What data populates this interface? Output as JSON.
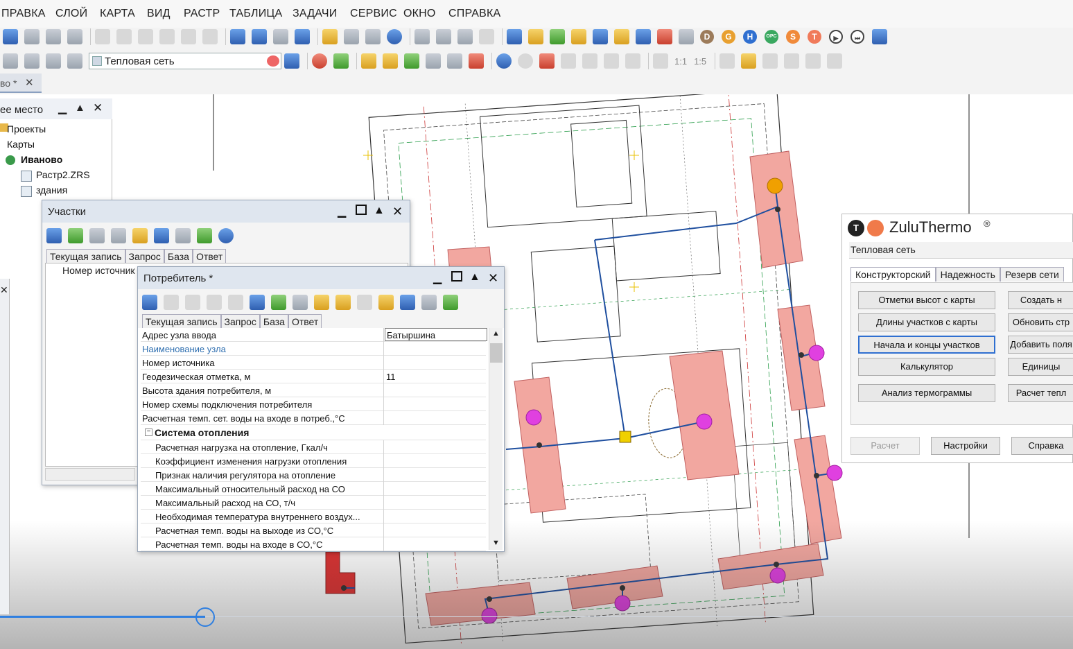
{
  "menu": [
    "ПРАВКА",
    "СЛОЙ",
    "КАРТА",
    "ВИД",
    "РАСТР",
    "ТАБЛИЦА",
    "ЗАДАЧИ",
    "СЕРВИС",
    "ОКНО",
    "СПРАВКА"
  ],
  "toolbar2": {
    "layer_combo": "Тепловая сеть",
    "scale_1": "1:1",
    "scale_2": "1:5"
  },
  "plugin_icons": [
    "D",
    "G",
    "H",
    "OPC",
    "S",
    "T"
  ],
  "doc_tab": {
    "label": "во *",
    "close": "✕"
  },
  "workspace": {
    "title": "ее место",
    "items": [
      "Проекты",
      "Карты",
      "Иваново",
      "Растр2.ZRS",
      "здания"
    ]
  },
  "uchastki": {
    "title": "Участки",
    "tabs": [
      "Текущая запись",
      "Запрос",
      "База",
      "Ответ"
    ],
    "column": "Номер источник"
  },
  "consumer": {
    "title": "Потребитель *",
    "tabs": [
      "Текущая запись",
      "Запрос",
      "База",
      "Ответ"
    ],
    "rows": [
      {
        "key": "Адрес узла ввода",
        "value": "Батыршина"
      },
      {
        "key": "Наименование узла",
        "value": ""
      },
      {
        "key": "Номер источника",
        "value": ""
      },
      {
        "key": "Геодезическая отметка, м",
        "value": "11"
      },
      {
        "key": "Высота здания потребителя, м",
        "value": ""
      },
      {
        "key": "Номер схемы подключения потребителя",
        "value": ""
      },
      {
        "key": "Расчетная темп. сет. воды на входе в потреб.,°С",
        "value": ""
      }
    ],
    "group": "Система отопления",
    "group_toggle": "−",
    "subrows": [
      "Расчетная нагрузка на отопление, Гкал/ч",
      "Коэффициент изменения нагрузки отопления",
      "Признак наличия регулятора на отопление",
      "Максимальный относительный расход на СО",
      "Максимальный расход на СО, т/ч",
      "Необходимая температура внутреннего воздух...",
      "Расчетная темп. воды на выходе из СО,°С",
      "Расчетная темп. воды на входе в СО,°С"
    ]
  },
  "zulu": {
    "logo_t": "T",
    "brand": "ZuluThermo",
    "reg": "®",
    "layer": "Тепловая сеть",
    "tabs": [
      "Конструкторский",
      "Надежность",
      "Резерв сети"
    ],
    "left_buttons": [
      "Отметки высот с карты",
      "Длины участков с карты",
      "Начала и концы участков",
      "Калькулятор",
      "Анализ термограммы"
    ],
    "right_buttons": [
      "Создать н",
      "Обновить стр",
      "Добавить поля",
      "Единицы",
      "Расчет тепл"
    ],
    "bottom": {
      "calc": "Расчет",
      "settings": "Настройки",
      "help": "Справка"
    }
  },
  "colors": {
    "accent": "#2f6fd0",
    "pipe": "#1f4f9f",
    "building": "#f2a7a0",
    "node_pink": "#e040e0",
    "node_yellow": "#f0d000"
  }
}
